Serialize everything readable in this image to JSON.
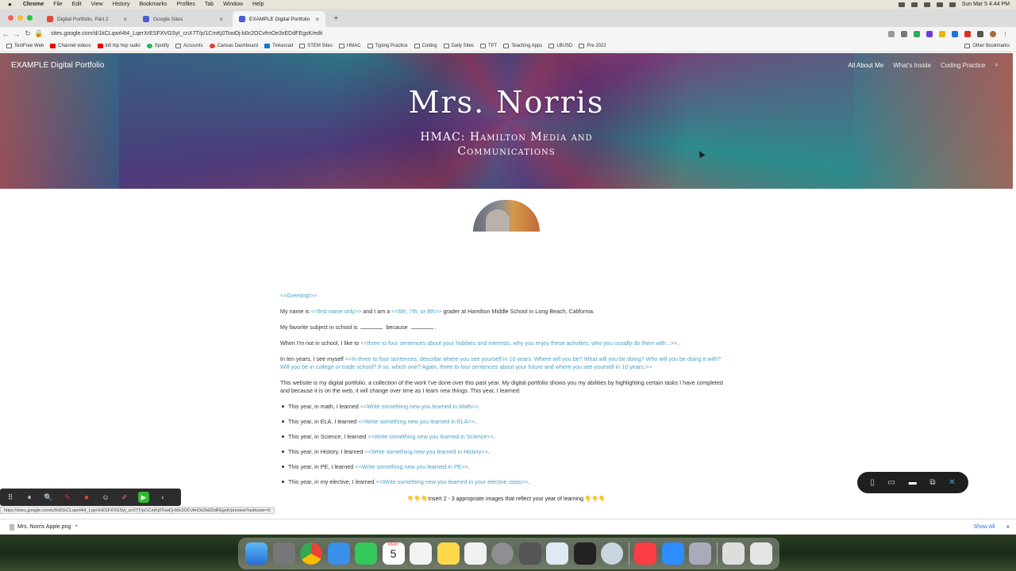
{
  "menubar": {
    "app": "Chrome",
    "items": [
      "File",
      "Edit",
      "View",
      "History",
      "Bookmarks",
      "Profiles",
      "Tab",
      "Window",
      "Help"
    ],
    "clock": "Sun Mar 5  4:44 PM"
  },
  "tabs": [
    {
      "label": "Digital Portfolio, Part 2",
      "color": "#e34a3d"
    },
    {
      "label": "Google Sites",
      "color": "#4f5bd5"
    },
    {
      "label": "EXAMPLE Digital Portfolio",
      "color": "#4f5bd5"
    }
  ],
  "address": {
    "url": "sites.google.com/d/1kCLqwrl4t4_LqerXrESFXVGSyt_cnX7T/p/1CmKj0TowDj-b0c2OCvfmOe3xEDdFEgsK/edit"
  },
  "bookmarks": [
    "TextFree Web",
    "Channel videos",
    "lofi hip hop radio",
    "Spotify",
    "Accounts",
    "Canvas Dashboard",
    "Tinkercad",
    "STEM Sites",
    "HMAC",
    "Typing Practice",
    "Coding",
    "Daily Sites",
    "TPT",
    "Teaching Apps",
    "LBUSD",
    "Pre 2022"
  ],
  "bookmarks_other": "Other Bookmarks",
  "site": {
    "brand": "EXAMPLE Digital Portfolio",
    "nav": [
      "All About Me",
      "What's Inside",
      "Coding Practice"
    ],
    "title": "Mrs. Norris",
    "subtitle_line1": "HMAC: Hamilton Media and",
    "subtitle_line2": "Communications"
  },
  "content": {
    "greeting": "<<Greeting!>>",
    "p1_a": "My name is ",
    "p1_ph1": "<<first name only>>",
    "p1_b": " and I am a ",
    "p1_ph2": "<<6th, 7th, or 8th>>",
    "p1_c": " grader at Hamilton Middle School in Long Beach, California.",
    "p2_a": "My favorite subject in school is ",
    "p2_b": " because ",
    "p2_c": ".",
    "p3_a": "When I'm not in school, I like to ",
    "p3_ph": "<<three to four sentences about your hobbies and interests, why you enjoy these activities, who you usually do them with...>>",
    "p3_end": ".",
    "p4_a": "In ten years, I see myself ",
    "p4_ph": "<<In three to four sentences, describe where you see yourself in 10 years. Where will you be? What will you be doing? Who will you be doing it with? Will you be in college or trade school? If so, which one? Again, three to four sentences about your future and where you see yourself in 10 years.>>",
    "p5": "This website is my digital portfolio, a collection of the work I've done over this past year. My digital portfolio shows you my abilities by highlighting certain tasks I have completed and because it is on the web, it will change over time as I learn new things. This year, I learned:",
    "list": [
      {
        "lead": "This year, in math, I learned ",
        "ph": "<<Write something new you learned in Math>>",
        "end": "."
      },
      {
        "lead": "This year, in ELA, I learned ",
        "ph": "<<Write something new you learned in ELA>>",
        "end": "."
      },
      {
        "lead": "This year, in Science, I learned ",
        "ph": "<<Write something new you learned in Science>>",
        "end": "."
      },
      {
        "lead": "This year, in History, I learned ",
        "ph": "<<Write something new you learned in History>>",
        "end": "."
      },
      {
        "lead": "This year, in PE, I learned ",
        "ph": "<<Write something new you learned in PE>>",
        "end": "."
      },
      {
        "lead": "This year, in my elective, I learned ",
        "ph": "<<Write something new you learned in your elective class>>",
        "end": "."
      }
    ],
    "insert": "👇👇👇Insert 2 - 3 appropriate images that reflect your year of learning.👇👇👇"
  },
  "status_url": "https://sites.google.com/u/0/d/1kCLqwrl4t4_LqerXrESFXVGSyt_cnX7T/p/1CmKj0TowDj-b0c2OCvfmOe3xEDdFEgsK/preview?authuser=0",
  "downloads": {
    "file": "Mrs. Norris Apple.png",
    "show_all": "Show All"
  },
  "dock_date": {
    "month": "MAR",
    "day": "5"
  }
}
